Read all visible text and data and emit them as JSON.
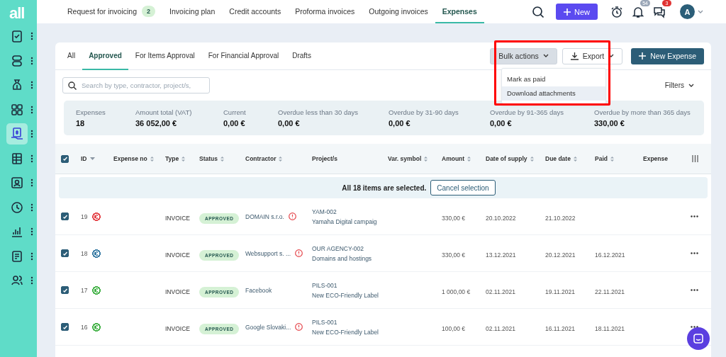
{
  "sidebar": {
    "logo": "all",
    "items": [
      {
        "kind": "clipboard",
        "selected": false
      },
      {
        "kind": "stack",
        "selected": false
      },
      {
        "kind": "moneybag",
        "selected": false
      },
      {
        "kind": "grid",
        "selected": false
      },
      {
        "kind": "invoice",
        "selected": true
      },
      {
        "kind": "sheet",
        "selected": false
      },
      {
        "kind": "contact",
        "selected": false
      },
      {
        "kind": "clock",
        "selected": false
      },
      {
        "kind": "chart",
        "selected": false
      },
      {
        "kind": "doclist",
        "selected": false
      },
      {
        "kind": "people",
        "selected": false
      }
    ]
  },
  "top_nav": {
    "tabs": [
      {
        "label": "Request for invoicing",
        "badge": "2",
        "selected": false
      },
      {
        "label": "Invoicing plan",
        "selected": false
      },
      {
        "label": "Credit accounts",
        "selected": false
      },
      {
        "label": "Proforma invoices",
        "selected": false
      },
      {
        "label": "Outgoing invoices",
        "selected": false
      },
      {
        "label": "Expenses",
        "selected": true
      }
    ],
    "new_button": "New",
    "notifications_badge": "54",
    "messages_badge": "3",
    "avatar": "A"
  },
  "card": {
    "tabs": [
      {
        "label": "All",
        "selected": false
      },
      {
        "label": "Approved",
        "selected": true
      },
      {
        "label": "For Items Approval",
        "selected": false
      },
      {
        "label": "For Financial Approval",
        "selected": false
      },
      {
        "label": "Drafts",
        "selected": false
      }
    ],
    "bulk_actions": "Bulk actions",
    "export": "Export",
    "new_expense": "New Expense",
    "bulk_menu": [
      {
        "label": "Mark as paid",
        "selected": false
      },
      {
        "label": "Download attachments",
        "selected": true
      }
    ],
    "highlight_frame": true,
    "search": {
      "placeholder": "Search by type, contractor, project/s,"
    },
    "filters": "Filters",
    "stats": [
      {
        "label": "Expenses",
        "value": "18"
      },
      {
        "label": "Amount total (VAT)",
        "value": "36 052,00 €"
      },
      {
        "label": "Current",
        "value": "0,00 €"
      },
      {
        "label": "Overdue less than 30 days",
        "value": "0,00 €"
      },
      {
        "label": "Overdue by 31-90 days",
        "value": "0,00 €"
      },
      {
        "label": "Overdue by 91-365 days",
        "value": "0,00 €"
      },
      {
        "label": "Overdue by more than 365 days",
        "value": "330,00 €"
      }
    ]
  },
  "table": {
    "all_checked": true,
    "columns": [
      {
        "label": "ID",
        "sortable": true,
        "sorted": true
      },
      {
        "label": "Expense no",
        "sortable": true,
        "sorted": false
      },
      {
        "label": "Type",
        "sortable": true,
        "sorted": false
      },
      {
        "label": "Status",
        "sortable": true,
        "sorted": false
      },
      {
        "label": "Contractor",
        "sortable": true,
        "sorted": false
      },
      {
        "label": "Project/s",
        "sortable": false,
        "sorted": false
      },
      {
        "label": "Var. symbol",
        "sortable": true,
        "sorted": false
      },
      {
        "label": "Amount",
        "sortable": true,
        "sorted": false
      },
      {
        "label": "Date of supply",
        "sortable": true,
        "sorted": false
      },
      {
        "label": "Due date",
        "sortable": true,
        "sorted": false
      },
      {
        "label": "Paid",
        "sortable": true,
        "sorted": false
      },
      {
        "label": "Expense",
        "sortable": false,
        "sorted": false
      }
    ],
    "selection_banner": {
      "text": "All 18 items are selected.",
      "button": "Cancel selection"
    },
    "rows": [
      {
        "checked": true,
        "id": "19",
        "color": "#e5484d",
        "type": "INVOICE",
        "status": "APPROVED",
        "contractor": "DOMAIN s.r.o.",
        "warning": true,
        "project_code": "YAM-002",
        "project_name": "Yamaha Digital campaig",
        "amount": "330,00 €",
        "date_of_supply": "20.10.2022",
        "due_date": "21.10.2022"
      },
      {
        "checked": true,
        "id": "18",
        "color": "#3d7ea6",
        "type": "INVOICE",
        "status": "APPROVED",
        "contractor": "Websupport s. ...",
        "warning": true,
        "project_code": "OUR AGENCY-002",
        "project_name": "Domains and hostings",
        "amount": "330,00 €",
        "date_of_supply": "13.12.2021",
        "due_date": "20.12.2021",
        "paid": "16.12.2021"
      },
      {
        "checked": true,
        "id": "17",
        "color": "#46b34a",
        "type": "INVOICE",
        "status": "APPROVED",
        "contractor": "Facebook",
        "warning": false,
        "project_code": "PILS-001",
        "project_name": "New ECO-Friendly Label",
        "amount": "1 000,00 €",
        "date_of_supply": "02.11.2021",
        "due_date": "19.11.2021",
        "paid": "22.11.2021"
      },
      {
        "checked": true,
        "id": "16",
        "color": "#46b34a",
        "type": "INVOICE",
        "status": "APPROVED",
        "contractor": "Google Slovaki...",
        "warning": true,
        "project_code": "PILS-001",
        "project_name": "New ECO-Friendly Label",
        "amount": "100,00 €",
        "date_of_supply": "02.11.2021",
        "due_date": "16.11.2021",
        "paid": "18.11.2021"
      }
    ]
  }
}
